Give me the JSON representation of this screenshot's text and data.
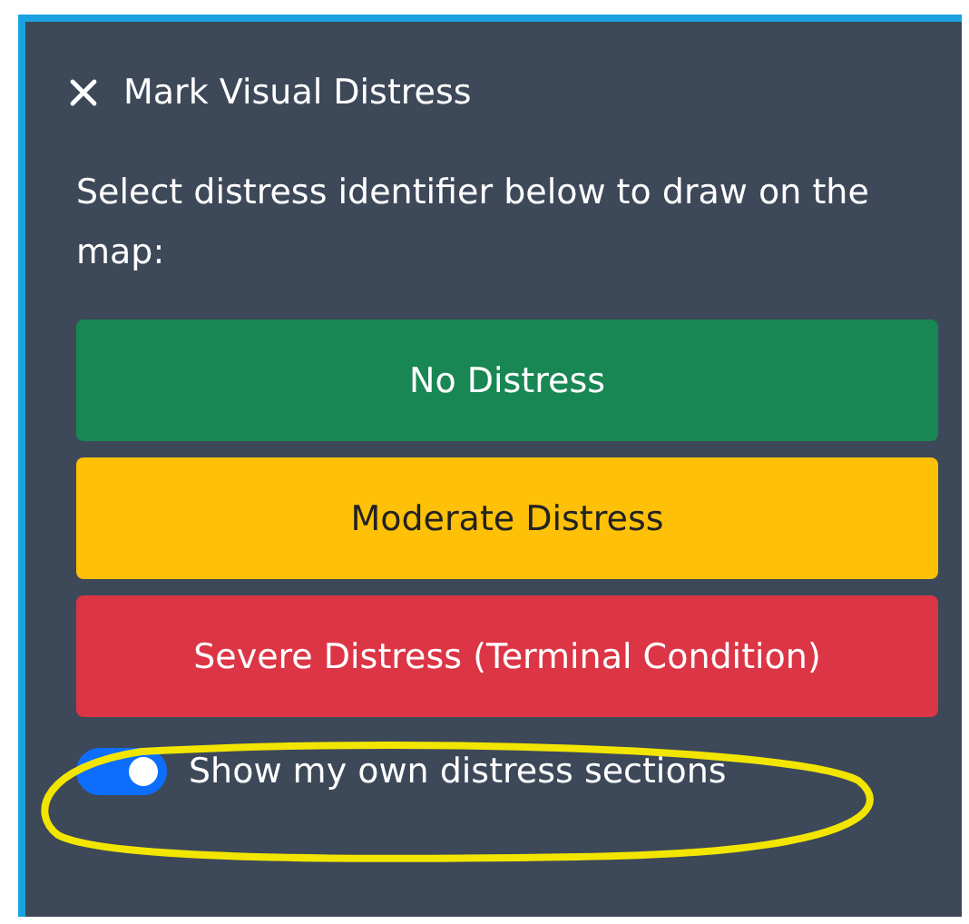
{
  "panel": {
    "title": "Mark Visual Distress",
    "description": "Select distress identifier below to draw on the map:"
  },
  "buttons": [
    {
      "label": "No Distress",
      "kind": "success"
    },
    {
      "label": "Moderate Distress",
      "kind": "warning"
    },
    {
      "label": "Severe Distress (Terminal Condition)",
      "kind": "danger"
    }
  ],
  "toggle": {
    "label": "Show my own distress sections",
    "on": true,
    "highlighted": true
  }
}
